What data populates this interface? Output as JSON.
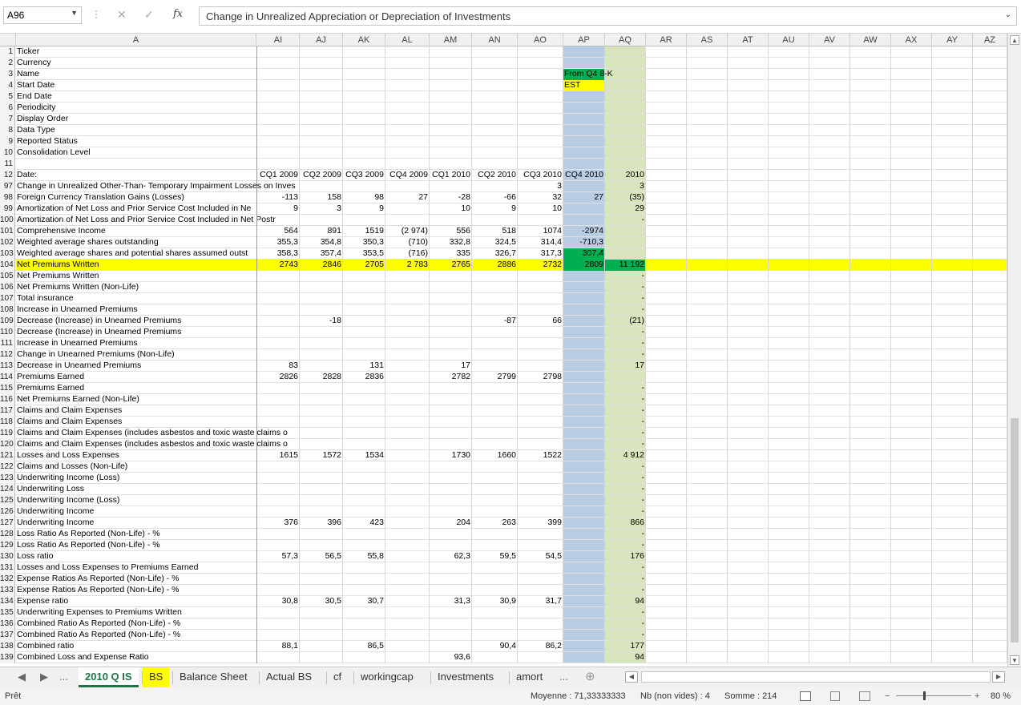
{
  "formula_bar": {
    "name_box": "A96",
    "content": "Change in Unrealized Appreciation or Depreciation of Investments",
    "fx_label": "fx"
  },
  "colors": {
    "yellow": "#ffff00",
    "blue_col": "#b8cce4",
    "green_col": "#d8e4bc",
    "green_cell": "#00b050",
    "tab_green": "#217346"
  },
  "columns": [
    {
      "id": "A",
      "label": "A"
    },
    {
      "id": "AI",
      "label": "AI"
    },
    {
      "id": "AJ",
      "label": "AJ"
    },
    {
      "id": "AK",
      "label": "AK"
    },
    {
      "id": "AL",
      "label": "AL"
    },
    {
      "id": "AM",
      "label": "AM"
    },
    {
      "id": "AN",
      "label": "AN"
    },
    {
      "id": "AO",
      "label": "AO"
    },
    {
      "id": "AP",
      "label": "AP"
    },
    {
      "id": "AQ",
      "label": "AQ"
    },
    {
      "id": "AR",
      "label": "AR"
    },
    {
      "id": "AS",
      "label": "AS"
    },
    {
      "id": "AT",
      "label": "AT"
    },
    {
      "id": "AU",
      "label": "AU"
    },
    {
      "id": "AV",
      "label": "AV"
    },
    {
      "id": "AW",
      "label": "AW"
    },
    {
      "id": "AX",
      "label": "AX"
    },
    {
      "id": "AY",
      "label": "AY"
    },
    {
      "id": "AZ",
      "label": "AZ"
    }
  ],
  "rows": [
    {
      "n": "1",
      "A": "Ticker"
    },
    {
      "n": "2",
      "A": "Currency"
    },
    {
      "n": "3",
      "A": "Name",
      "AP": "From Q4 8-K",
      "AP_fill": "green_cell"
    },
    {
      "n": "4",
      "A": "Start Date",
      "AP": "EST",
      "AP_fill": "yellow"
    },
    {
      "n": "5",
      "A": "End Date"
    },
    {
      "n": "6",
      "A": "Periodicity"
    },
    {
      "n": "7",
      "A": "Display Order"
    },
    {
      "n": "8",
      "A": "Data Type"
    },
    {
      "n": "9",
      "A": "Reported Status"
    },
    {
      "n": "10",
      "A": "Consolidation Level"
    },
    {
      "n": "11"
    },
    {
      "n": "12",
      "A": "Date:",
      "AI": "CQ1 2009",
      "AJ": "CQ2 2009",
      "AK": "CQ3 2009",
      "AL": "CQ4 2009",
      "AM": "CQ1 2010",
      "AN": "CQ2 2010",
      "AO": "CQ3 2010",
      "AP": "CQ4 2010",
      "AQ": "2010"
    },
    {
      "n": "97",
      "A": "Change in Unrealized Other-Than- Temporary Impairment Losses on Inves",
      "AO": "3",
      "AQ": "3"
    },
    {
      "n": "98",
      "A": "Foreign Currency Translation Gains (Losses)",
      "AI": "-113",
      "AJ": "158",
      "AK": "98",
      "AL": "27",
      "AM": "-28",
      "AN": "-66",
      "AO": "32",
      "AP": "27",
      "AQ": "(35)"
    },
    {
      "n": "99",
      "A": "Amortization of Net Loss and Prior Service Cost Included in Ne",
      "AI": "9",
      "AJ": "3",
      "AK": "9",
      "AM": "10",
      "AN": "9",
      "AO": "10",
      "AQ": "29"
    },
    {
      "n": "100",
      "A": "Amortization of Net Loss and Prior Service Cost Included in Net Postr",
      "AQ": "-"
    },
    {
      "n": "101",
      "A": "Comprehensive Income",
      "AI": "564",
      "AJ": "891",
      "AK": "1519",
      "AL": "(2 974)",
      "AM": "556",
      "AN": "518",
      "AO": "1074",
      "AP": "-2974"
    },
    {
      "n": "102",
      "A": "Weighted average shares outstanding",
      "AI": "355,3",
      "AJ": "354,8",
      "AK": "350,3",
      "AL": "(710)",
      "AM": "332,8",
      "AN": "324,5",
      "AO": "314,4",
      "AP": "-710,3"
    },
    {
      "n": "103",
      "A": "Weighted average shares and potential shares assumed outst",
      "AI": "358,3",
      "AJ": "357,4",
      "AK": "353,5",
      "AL": "(716)",
      "AM": "335",
      "AN": "326,7",
      "AO": "317,3",
      "AP": "307,4",
      "AP_fill": "green_cell"
    },
    {
      "n": "104",
      "A": "Net Premiums Written",
      "AI": "2743",
      "AJ": "2846",
      "AK": "2705",
      "AL": "2 783",
      "AM": "2765",
      "AN": "2886",
      "AO": "2732",
      "AP": "2809",
      "AQ": "11 192",
      "row_fill": "yellow",
      "AP_fill": "green_cell",
      "AQ_fill": "green_cell"
    },
    {
      "n": "105",
      "A": "Net Premiums Written",
      "AQ": "-"
    },
    {
      "n": "106",
      "A": "Net Premiums Written (Non-Life)",
      "AQ": "-"
    },
    {
      "n": "107",
      "A": "Total insurance",
      "AQ": "-"
    },
    {
      "n": "108",
      "A": "Increase in Unearned Premiums",
      "AQ": "-"
    },
    {
      "n": "109",
      "A": "Decrease (Increase) in Unearned Premiums",
      "AJ": "-18",
      "AN": "-87",
      "AO": "66",
      "AQ": "(21)"
    },
    {
      "n": "110",
      "A": "Decrease (Increase) in Unearned Premiums",
      "AQ": "-"
    },
    {
      "n": "111",
      "A": "Increase in Unearned Premiums",
      "AQ": "-"
    },
    {
      "n": "112",
      "A": "Change in Unearned Premiums (Non-Life)",
      "AQ": "-"
    },
    {
      "n": "113",
      "A": "Decrease in Unearned Premiums",
      "AI": "83",
      "AK": "131",
      "AM": "17",
      "AQ": "17"
    },
    {
      "n": "114",
      "A": "Premiums Earned",
      "AI": "2826",
      "AJ": "2828",
      "AK": "2836",
      "AM": "2782",
      "AN": "2799",
      "AO": "2798"
    },
    {
      "n": "115",
      "A": "Premiums Earned",
      "AQ": "-"
    },
    {
      "n": "116",
      "A": "Net Premiums Earned (Non-Life)",
      "AQ": "-"
    },
    {
      "n": "117",
      "A": "Claims and Claim Expenses",
      "AQ": "-"
    },
    {
      "n": "118",
      "A": "Claims and Claim Expenses",
      "AQ": "-"
    },
    {
      "n": "119",
      "A": "Claims and Claim Expenses (includes asbestos and toxic waste claims o",
      "AQ": "-"
    },
    {
      "n": "120",
      "A": "Claims and Claim Expenses (includes asbestos and toxic waste claims o",
      "AQ": "-"
    },
    {
      "n": "121",
      "A": "Losses and Loss Expenses",
      "AI": "1615",
      "AJ": "1572",
      "AK": "1534",
      "AM": "1730",
      "AN": "1660",
      "AO": "1522",
      "AQ": "4 912"
    },
    {
      "n": "122",
      "A": "Claims and Losses (Non-Life)",
      "AQ": "-"
    },
    {
      "n": "123",
      "A": "Underwriting Income (Loss)",
      "AQ": "-"
    },
    {
      "n": "124",
      "A": "Underwriting Loss",
      "AQ": "-"
    },
    {
      "n": "125",
      "A": "Underwriting Income (Loss)",
      "AQ": "-"
    },
    {
      "n": "126",
      "A": "Underwriting Income",
      "AQ": "-"
    },
    {
      "n": "127",
      "A": "Underwriting Income",
      "AI": "376",
      "AJ": "396",
      "AK": "423",
      "AM": "204",
      "AN": "263",
      "AO": "399",
      "AQ": "866"
    },
    {
      "n": "128",
      "A": "Loss Ratio As Reported (Non-Life) - %",
      "AQ": "-"
    },
    {
      "n": "129",
      "A": "Loss Ratio As Reported (Non-Life) - %",
      "AQ": "-"
    },
    {
      "n": "130",
      "A": "Loss ratio",
      "AI": "57,3",
      "AJ": "56,5",
      "AK": "55,8",
      "AM": "62,3",
      "AN": "59,5",
      "AO": "54,5",
      "AQ": "176"
    },
    {
      "n": "131",
      "A": "Losses and Loss Expenses to  Premiums Earned",
      "AQ": "-"
    },
    {
      "n": "132",
      "A": "Expense Ratios As Reported (Non-Life) - %",
      "AQ": "-"
    },
    {
      "n": "133",
      "A": "Expense Ratios As Reported (Non-Life) - %",
      "AQ": "-"
    },
    {
      "n": "134",
      "A": "Expense ratio",
      "AI": "30,8",
      "AJ": "30,5",
      "AK": "30,7",
      "AM": "31,3",
      "AN": "30,9",
      "AO": "31,7",
      "AQ": "94"
    },
    {
      "n": "135",
      "A": "Underwriting Expenses to  Premiums Written",
      "AQ": "-"
    },
    {
      "n": "136",
      "A": "Combined Ratio As Reported (Non-Life) - %",
      "AQ": "-"
    },
    {
      "n": "137",
      "A": "Combined Ratio As Reported (Non-Life) - %",
      "AQ": "-"
    },
    {
      "n": "138",
      "A": "Combined ratio",
      "AI": "88,1",
      "AK": "86,5",
      "AN": "90,4",
      "AO": "86,2",
      "AQ": "177"
    },
    {
      "n": "139",
      "A": "Combined Loss and Expense Ratio",
      "AM": "93,6",
      "AQ": "94"
    }
  ],
  "tabs": [
    {
      "label": "2010 Q IS",
      "style": "active"
    },
    {
      "label": "BS",
      "style": "yellow"
    },
    {
      "label": "Balance Sheet",
      "style": ""
    },
    {
      "label": "Actual BS",
      "style": ""
    },
    {
      "label": "cf",
      "style": ""
    },
    {
      "label": "workingcap",
      "style": ""
    },
    {
      "label": "Investments",
      "style": ""
    },
    {
      "label": "amort",
      "style": ""
    }
  ],
  "tab_nav": {
    "prev": "◀",
    "next": "▶",
    "more_left": "...",
    "more_right": "...",
    "add": "⊕"
  },
  "status": {
    "ready": "Prêt",
    "average": "Moyenne : 71,33333333",
    "count": "Nb (non vides) : 4",
    "sum": "Somme : 214",
    "zoom": "80 %"
  }
}
